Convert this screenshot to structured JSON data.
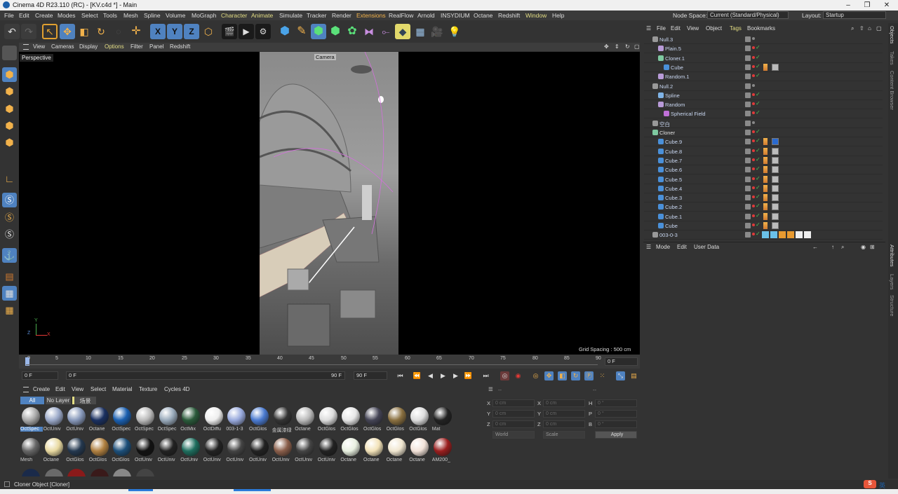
{
  "window": {
    "title": "Cinema 4D R23.110 (RC) - [KV.c4d *] - Main"
  },
  "menu": [
    "File",
    "Edit",
    "Create",
    "Modes",
    "Select",
    "Tools",
    "Mesh",
    "Spline",
    "Volume",
    "MoGraph",
    "Character",
    "Animate",
    "Simulate",
    "Tracker",
    "Render",
    "Extensions",
    "RealFlow",
    "Arnold",
    "INSYDIUM",
    "Octane",
    "Redshift",
    "Window",
    "Help"
  ],
  "nodespace": {
    "label": "Node Space:",
    "value": "Current (Standard/Physical)"
  },
  "layout": {
    "label": "Layout:",
    "value": "Startup"
  },
  "viewport": {
    "menu": [
      "View",
      "Cameras",
      "Display",
      "Options",
      "Filter",
      "Panel",
      "Redshift"
    ],
    "label": "Perspective",
    "camera": "Camera",
    "grid": "Grid Spacing : 500 cm"
  },
  "timeline": {
    "ticks": [
      "0",
      "5",
      "10",
      "15",
      "20",
      "25",
      "30",
      "35",
      "40",
      "45",
      "50",
      "55",
      "60",
      "65",
      "70",
      "75",
      "80",
      "85",
      "90"
    ],
    "frame_right": "0 F"
  },
  "transport": {
    "start": "0 F",
    "current": "0 F",
    "end1": "90 F",
    "end2": "90 F"
  },
  "materials": {
    "menu": [
      "Create",
      "Edit",
      "View",
      "Select",
      "Material",
      "Texture",
      "Cycles 4D"
    ],
    "filters": [
      "All",
      "No Layer",
      "场景"
    ],
    "row1": [
      "OctSpec",
      "OctUniv",
      "OctUniv",
      "Octane",
      "OctSpec",
      "OctSpec",
      "OctSpec",
      "OctMix",
      "OctDiffu",
      "003-1-3",
      "OctGlos",
      "金属漆绿",
      "Octane",
      "OctGlos",
      "OctGlos",
      "OctGlos",
      "OctGlos",
      "OctGlos",
      "Mat"
    ],
    "row2": [
      "Mesh",
      "Octane",
      "OctGlos",
      "OctGlos",
      "OctGlos",
      "OctUniv",
      "OctUniv",
      "OctUniv",
      "OctUniv",
      "OctUniv",
      "OctUniv",
      "OctUniv",
      "OctUniv",
      "OctUniv",
      "Octane",
      "Octane",
      "Octane",
      "Octane",
      "AM200_"
    ]
  },
  "coords": {
    "labels": [
      "X",
      "Y",
      "Z",
      "X",
      "Y",
      "Z",
      "H",
      "P",
      "B"
    ],
    "value": "0 cm",
    "angle": "0 °",
    "world": "World",
    "scale": "Scale",
    "apply": "Apply",
    "dash1": "--",
    "dash2": "--"
  },
  "objects": {
    "menu": [
      "File",
      "Edit",
      "View",
      "Object",
      "Tags",
      "Bookmarks"
    ],
    "rows": [
      {
        "n": "Null.3",
        "d": 0,
        "c": "#999"
      },
      {
        "n": "Plain.5",
        "d": 1,
        "c": "#b89bd8"
      },
      {
        "n": "Cloner.1",
        "d": 1,
        "c": "#7ec8a0"
      },
      {
        "n": "Cube",
        "d": 2,
        "c": "#4a90d9"
      },
      {
        "n": "Random.1",
        "d": 1,
        "c": "#b89bd8"
      },
      {
        "n": "Null.2",
        "d": 0,
        "c": "#999"
      },
      {
        "n": "Spline",
        "d": 1,
        "c": "#7fb3e6"
      },
      {
        "n": "Random",
        "d": 1,
        "c": "#b89bd8"
      },
      {
        "n": "Spherical Field",
        "d": 2,
        "c": "#c070d8"
      },
      {
        "n": "空白",
        "d": 0,
        "c": "#999"
      },
      {
        "n": "Cloner",
        "d": 0,
        "c": "#7ec8a0"
      },
      {
        "n": "Cube.9",
        "d": 1,
        "c": "#4a90d9"
      },
      {
        "n": "Cube.8",
        "d": 1,
        "c": "#4a90d9"
      },
      {
        "n": "Cube.7",
        "d": 1,
        "c": "#4a90d9"
      },
      {
        "n": "Cube.6",
        "d": 1,
        "c": "#4a90d9"
      },
      {
        "n": "Cube.5",
        "d": 1,
        "c": "#4a90d9"
      },
      {
        "n": "Cube.4",
        "d": 1,
        "c": "#4a90d9"
      },
      {
        "n": "Cube.3",
        "d": 1,
        "c": "#4a90d9"
      },
      {
        "n": "Cube.2",
        "d": 1,
        "c": "#4a90d9"
      },
      {
        "n": "Cube.1",
        "d": 1,
        "c": "#4a90d9"
      },
      {
        "n": "Cube",
        "d": 1,
        "c": "#4a90d9"
      },
      {
        "n": "003-0-3",
        "d": 0,
        "c": "#999"
      }
    ]
  },
  "attributes": {
    "menu": [
      "Mode",
      "Edit",
      "User Data"
    ]
  },
  "sidetabs": [
    "Objects",
    "Takes",
    "Content Browser",
    "Attributes",
    "Layers",
    "Structure"
  ],
  "status": "Cloner Object [Cloner]",
  "ime": "英"
}
